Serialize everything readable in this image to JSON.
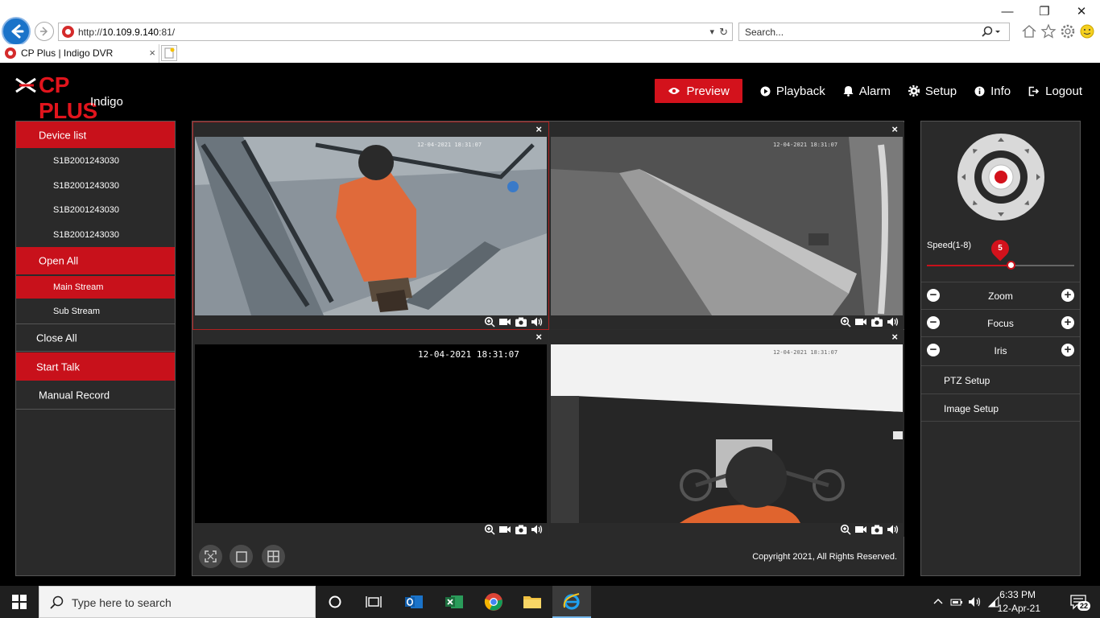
{
  "browser": {
    "url_prefix": "http://",
    "url_host": "10.109.9.140",
    "url_suffix": ":81/",
    "search_placeholder": "Search...",
    "tab_title": "CP Plus | Indigo DVR",
    "tab_close": "×"
  },
  "brand": {
    "name": "CP PLUS",
    "sub": "Indigo",
    "accent": "#d3121c"
  },
  "nav": {
    "items": [
      {
        "label": "Preview",
        "icon": "eye-icon",
        "active": true
      },
      {
        "label": "Playback",
        "icon": "play-circle-icon"
      },
      {
        "label": "Alarm",
        "icon": "bell-icon"
      },
      {
        "label": "Setup",
        "icon": "gear-icon"
      },
      {
        "label": "Info",
        "icon": "info-icon"
      },
      {
        "label": "Logout",
        "icon": "logout-icon"
      }
    ]
  },
  "left_panel": {
    "device_list": "Device list",
    "devices": [
      "S1B2001243030",
      "S1B2001243030",
      "S1B2001243030",
      "S1B2001243030"
    ],
    "open_all": "Open All",
    "main_stream": "Main Stream",
    "sub_stream": "Sub Stream",
    "close_all": "Close All",
    "start_talk": "Start Talk",
    "manual_record": "Manual Record"
  },
  "cameras": {
    "close": "×",
    "cam3_timestamp": "12-04-2021 18:31:07"
  },
  "footer": {
    "copyright": "Copyright 2021, All Rights Reserved."
  },
  "ptz": {
    "speed_label": "Speed(1-8)",
    "speed_value": "5",
    "speed_fraction": 0.571,
    "zoom": "Zoom",
    "focus": "Focus",
    "iris": "Iris",
    "ptz_setup": "PTZ Setup",
    "image_setup": "Image Setup"
  },
  "taskbar": {
    "search_placeholder": "Type here to search",
    "time": "6:33 PM",
    "date": "12-Apr-21",
    "notifications": "22"
  }
}
